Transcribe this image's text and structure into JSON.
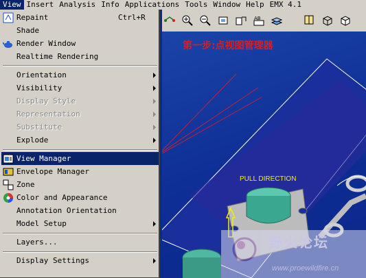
{
  "menubar": {
    "items": [
      "View",
      "Insert",
      "Analysis",
      "Info",
      "Applications",
      "Tools",
      "Window",
      "Help",
      "EMX 4.1"
    ]
  },
  "view_menu": {
    "repaint": {
      "label": "Repaint",
      "shortcut": "Ctrl+R"
    },
    "shade": "Shade",
    "render_window": "Render Window",
    "realtime_rendering": "Realtime Rendering",
    "orientation": "Orientation",
    "visibility": "Visibility",
    "display_style": "Display Style",
    "representation": "Representation",
    "substitute": "Substitute",
    "explode": "Explode",
    "view_manager": "View Manager",
    "envelope_manager": "Envelope Manager",
    "zone": "Zone",
    "color_and_appearance": "Color and Appearance",
    "annotation_orientation": "Annotation Orientation",
    "model_setup": "Model Setup",
    "layers": "Layers...",
    "display_settings": "Display Settings"
  },
  "viewport": {
    "annotation": "第一步:点视图管理器",
    "pull_direction": "PULL DIRECTION",
    "watermark_text": "野火论坛",
    "watermark_url": "www.proewildfire.cn"
  },
  "colors": {
    "menu_bg": "#d4d0c8",
    "highlight": "#0a246a",
    "viewport_bg": "#0e2f96",
    "annotation": "#d81e1e",
    "pull_direction": "#f0f000",
    "part": "#4fb8a0"
  }
}
